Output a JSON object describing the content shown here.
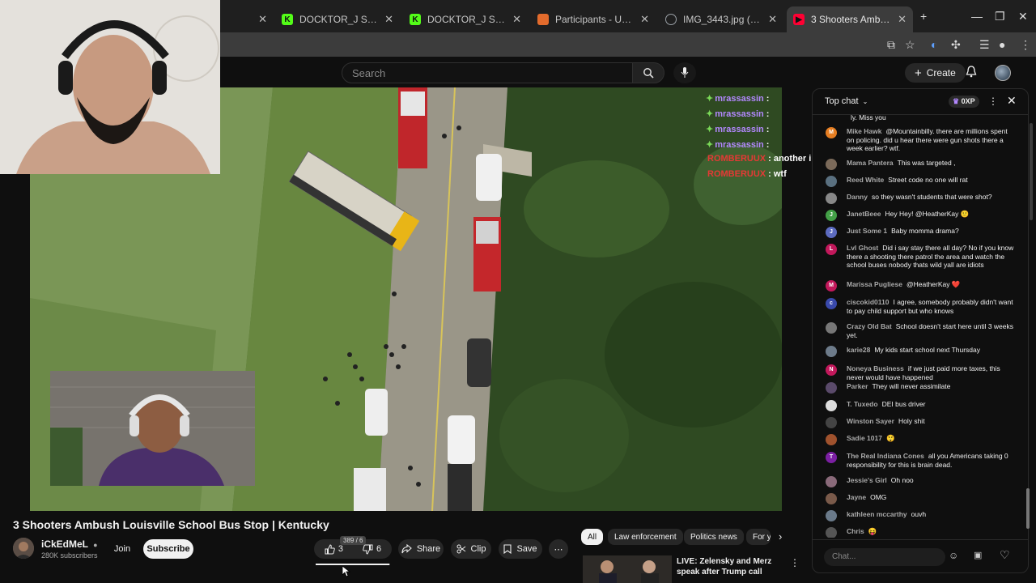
{
  "browser": {
    "tabs": [
      {
        "title": "DOCKTOR_J Stream - Watch Li...",
        "icon": "kick-icon",
        "color": "#53fc18"
      },
      {
        "title": "DOCKTOR_J Stream - Watch Li...",
        "icon": "kick-icon",
        "color": "#53fc18"
      },
      {
        "title": "Participants - UK Qualifier : AOI...",
        "icon": "flag-icon",
        "color": "#e36b2c"
      },
      {
        "title": "IMG_3443.jpg (416×901)",
        "icon": "globe-icon",
        "color": "#9aa0a6"
      },
      {
        "title": "3 Shooters Ambush Louisville S...",
        "icon": "youtube-icon",
        "color": "#ff0033",
        "active": true
      }
    ]
  },
  "header": {
    "search_placeholder": "Search",
    "create_label": "Create"
  },
  "video": {
    "overlay_chat": [
      {
        "user": "mrassassin",
        "text": ":",
        "color": "#b388ff"
      },
      {
        "user": "mrassassin",
        "text": ":",
        "color": "#b388ff"
      },
      {
        "user": "mrassassin",
        "text": ":",
        "color": "#b388ff"
      },
      {
        "user": "mrassassin",
        "text": ":",
        "color": "#b388ff"
      },
      {
        "user": "ROMBERUUX",
        "text": ": another incident",
        "color": "#e53935"
      },
      {
        "user": "ROMBERUUX",
        "text": ": wtf",
        "color": "#e53935"
      }
    ],
    "title": "3 Shooters Ambush Louisville School Bus Stop | Kentucky",
    "channel_name": "iCkEdMeL",
    "subscribers": "280K subscribers",
    "join_label": "Join",
    "subscribe_label": "Subscribe",
    "like_count": "3",
    "dislike_count": "6",
    "like_tooltip": "389 / 6",
    "like_ratio": 0.985,
    "share_label": "Share",
    "clip_label": "Clip",
    "save_label": "Save"
  },
  "recommendations": {
    "chips": [
      "All",
      "Law enforcement",
      "Politics news",
      "For y"
    ],
    "first_title": "LIVE: Zelensky and Merz speak after Trump call"
  },
  "chat": {
    "mode": "Top chat",
    "points": "0XP",
    "input_placeholder": "Chat...",
    "messages": [
      {
        "name": "",
        "text": "ly. Miss you",
        "avatar_letter": "",
        "avatar_color": "#555"
      },
      {
        "name": "Mike Hawk",
        "text": "@Mountainbilly. there are millions spent on policing. did u hear there were gun shots there a week earlier? wtf.",
        "avatar_letter": "M",
        "avatar_color": "#e67e22"
      },
      {
        "name": "Mama Pantera",
        "text": "This was targeted ,",
        "avatar_letter": "",
        "avatar_color": "#7b6a5a"
      },
      {
        "name": "Reed White",
        "text": "Street code no one will rat",
        "avatar_letter": "",
        "avatar_color": "#5a7080"
      },
      {
        "name": "Danny",
        "text": "so they wasn't students that were shot?",
        "avatar_letter": "",
        "avatar_color": "#888"
      },
      {
        "name": "JanetBeee",
        "text": "Hey Hey! @HeatherKay 🙂",
        "avatar_letter": "J",
        "avatar_color": "#43a047"
      },
      {
        "name": "Just Some 1",
        "text": "Baby momma drama?",
        "avatar_letter": "J",
        "avatar_color": "#5c6bc0"
      },
      {
        "name": "Lvl Ghost",
        "text": "Did i say stay there all day? No if you know there a shooting there patrol the area and watch the school buses nobody thats wild yall are idiots",
        "avatar_letter": "L",
        "avatar_color": "#c2185b"
      },
      {
        "name": "Marissa Pugliese",
        "text": "@HeatherKay ❤️",
        "avatar_letter": "M",
        "avatar_color": "#c2185b"
      },
      {
        "name": "ciscokid0110",
        "text": "I agree, somebody probably didn't want to pay child support but who knows",
        "avatar_letter": "c",
        "avatar_color": "#3949ab"
      },
      {
        "name": "Crazy Old Bat",
        "text": "School doesn't start here until 3 weeks yet.",
        "avatar_letter": "",
        "avatar_color": "#777"
      },
      {
        "name": "karie28",
        "text": "My kids start school next Thursday",
        "avatar_letter": "",
        "avatar_color": "#6d7b8a"
      },
      {
        "name": "Noneya Business",
        "text": "if we just paid more taxes, this never would have happened",
        "avatar_letter": "N",
        "avatar_color": "#c2185b"
      },
      {
        "name": "Parker",
        "text": "They will never assimilate",
        "avatar_letter": "",
        "avatar_color": "#5a4a6a"
      },
      {
        "name": "T. Tuxedo",
        "text": "DEI bus driver",
        "avatar_letter": "",
        "avatar_color": "#ddd"
      },
      {
        "name": "Winston Sayer",
        "text": "Holy shit",
        "avatar_letter": "",
        "avatar_color": "#444"
      },
      {
        "name": "Sadie 1017",
        "text": "😲",
        "avatar_letter": "",
        "avatar_color": "#a0522d"
      },
      {
        "name": "The Real Indiana Cones",
        "text": "all you Americans taking 0 responsibility for this is brain dead.",
        "avatar_letter": "T",
        "avatar_color": "#7b1fa2"
      },
      {
        "name": "Jessie's Girl",
        "text": "Oh noo",
        "avatar_letter": "",
        "avatar_color": "#8a6a7a"
      },
      {
        "name": "Jayne",
        "text": "OMG",
        "avatar_letter": "",
        "avatar_color": "#7a5a4a"
      },
      {
        "name": "kathleen mccarthy",
        "text": "ouvh",
        "avatar_letter": "",
        "avatar_color": "#6a7a8a"
      },
      {
        "name": "Chris",
        "text": "😝",
        "avatar_letter": "",
        "avatar_color": "#555"
      }
    ]
  }
}
